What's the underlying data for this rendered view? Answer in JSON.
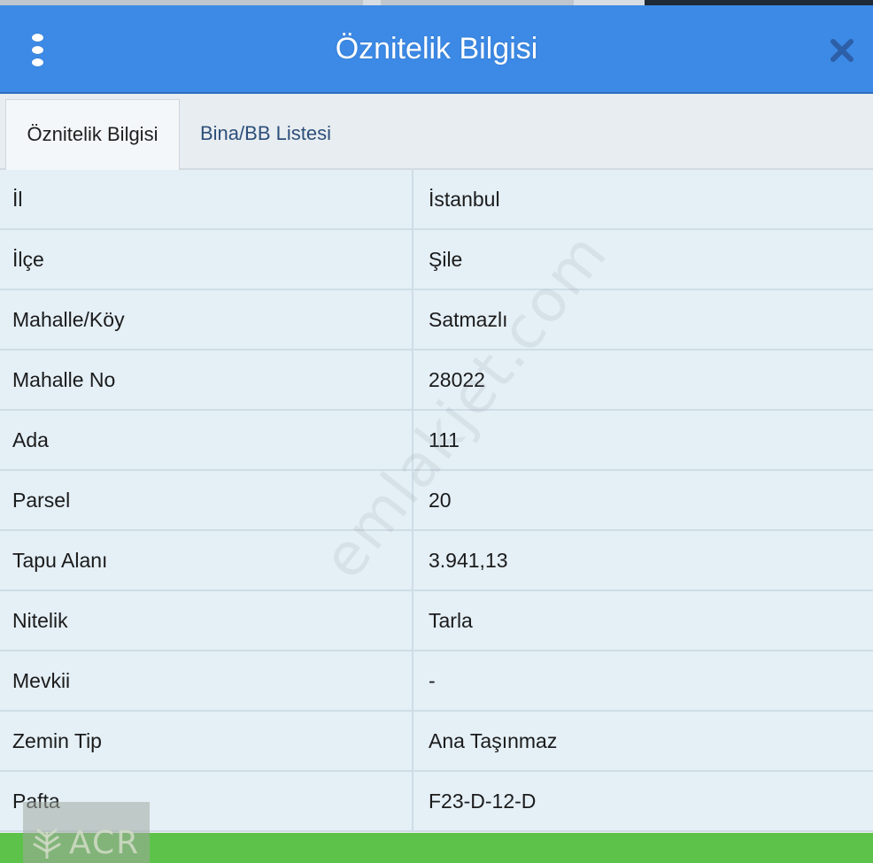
{
  "header": {
    "title": "Öznitelik Bilgisi",
    "color": "#3c8ae6"
  },
  "tabs": [
    {
      "label": "Öznitelik Bilgisi",
      "active": true
    },
    {
      "label": "Bina/BB Listesi",
      "active": false
    }
  ],
  "rows": [
    {
      "key": "İl",
      "value": "İstanbul"
    },
    {
      "key": "İlçe",
      "value": "Şile"
    },
    {
      "key": "Mahalle/Köy",
      "value": "Satmazlı"
    },
    {
      "key": "Mahalle No",
      "value": "28022"
    },
    {
      "key": "Ada",
      "value": "111"
    },
    {
      "key": "Parsel",
      "value": "20"
    },
    {
      "key": "Tapu Alanı",
      "value": "3.941,13"
    },
    {
      "key": "Nitelik",
      "value": "Tarla"
    },
    {
      "key": "Mevkii",
      "value": "-"
    },
    {
      "key": "Zemin Tip",
      "value": "Ana Taşınmaz"
    },
    {
      "key": "Pafta",
      "value": "F23-D-12-D"
    }
  ],
  "watermark": "emlakjet.com",
  "logo": {
    "text": "ACR"
  },
  "icons": {
    "menu": "vertical-dots-icon",
    "close": "close-icon"
  }
}
